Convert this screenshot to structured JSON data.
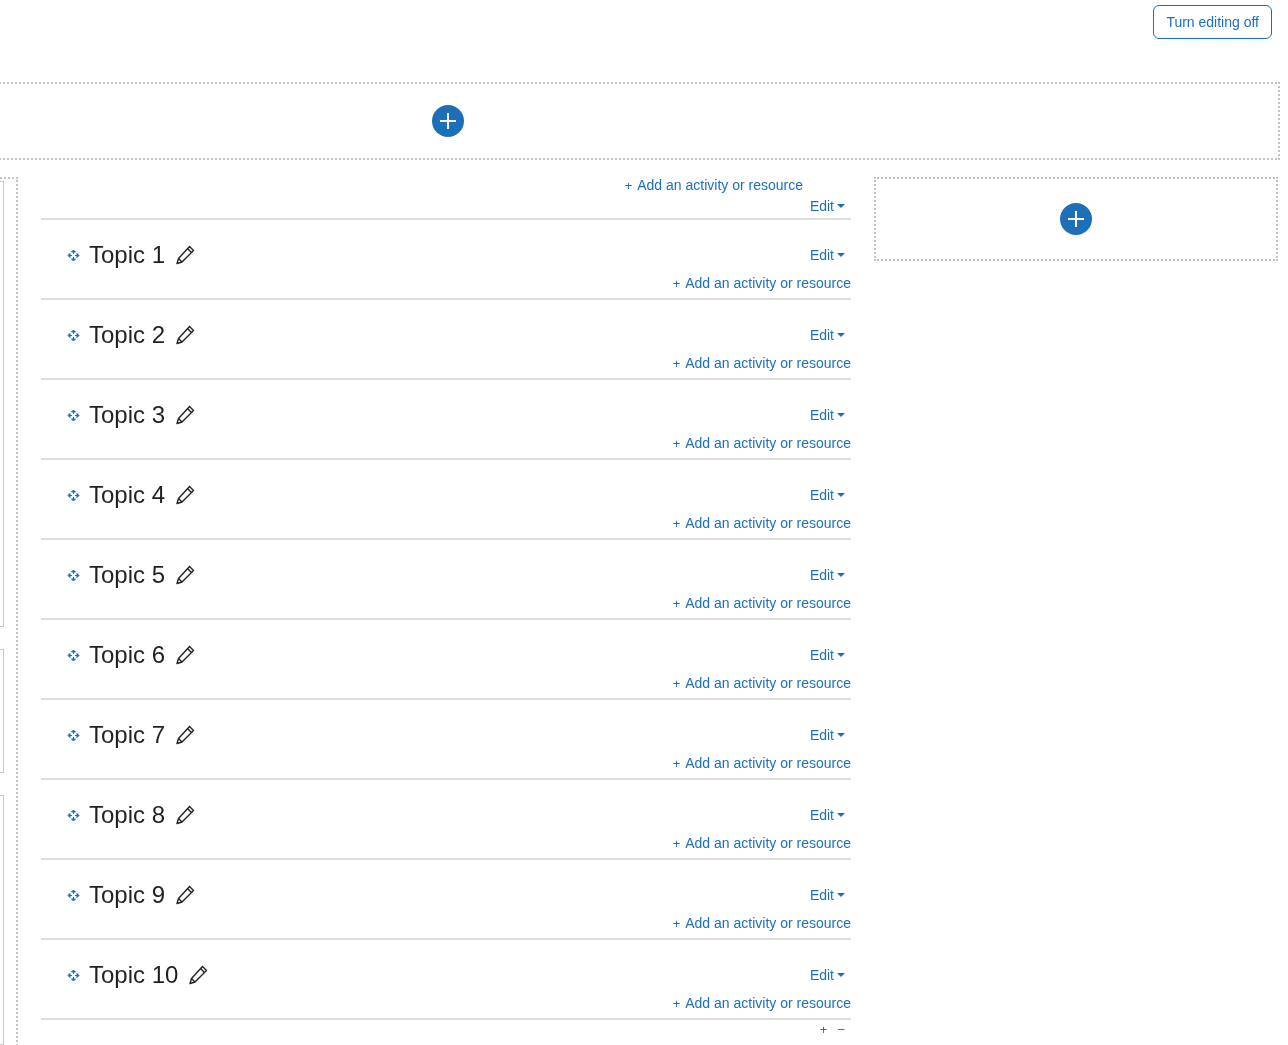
{
  "header": {
    "button": "Turn editing off"
  },
  "section_0": {
    "add_link": "Add an activity or resource",
    "add_mark": "+",
    "edit": "Edit"
  },
  "topics": [
    {
      "title": "Topic 1",
      "edit": "Edit",
      "add_mark": "+",
      "add_link": "Add an activity or resource"
    },
    {
      "title": "Topic 2",
      "edit": "Edit",
      "add_mark": "+",
      "add_link": "Add an activity or resource"
    },
    {
      "title": "Topic 3",
      "edit": "Edit",
      "add_mark": "+",
      "add_link": "Add an activity or resource"
    },
    {
      "title": "Topic 4",
      "edit": "Edit",
      "add_mark": "+",
      "add_link": "Add an activity or resource"
    },
    {
      "title": "Topic 5",
      "edit": "Edit",
      "add_mark": "+",
      "add_link": "Add an activity or resource"
    },
    {
      "title": "Topic 6",
      "edit": "Edit",
      "add_mark": "+",
      "add_link": "Add an activity or resource"
    },
    {
      "title": "Topic 7",
      "edit": "Edit",
      "add_mark": "+",
      "add_link": "Add an activity or resource"
    },
    {
      "title": "Topic 8",
      "edit": "Edit",
      "add_mark": "+",
      "add_link": "Add an activity or resource"
    },
    {
      "title": "Topic 9",
      "edit": "Edit",
      "add_mark": "+",
      "add_link": "Add an activity or resource"
    },
    {
      "title": "Topic 10",
      "edit": "Edit",
      "add_mark": "+",
      "add_link": "Add an activity or resource"
    }
  ],
  "section_controls": {
    "add": "+",
    "remove": "−"
  }
}
